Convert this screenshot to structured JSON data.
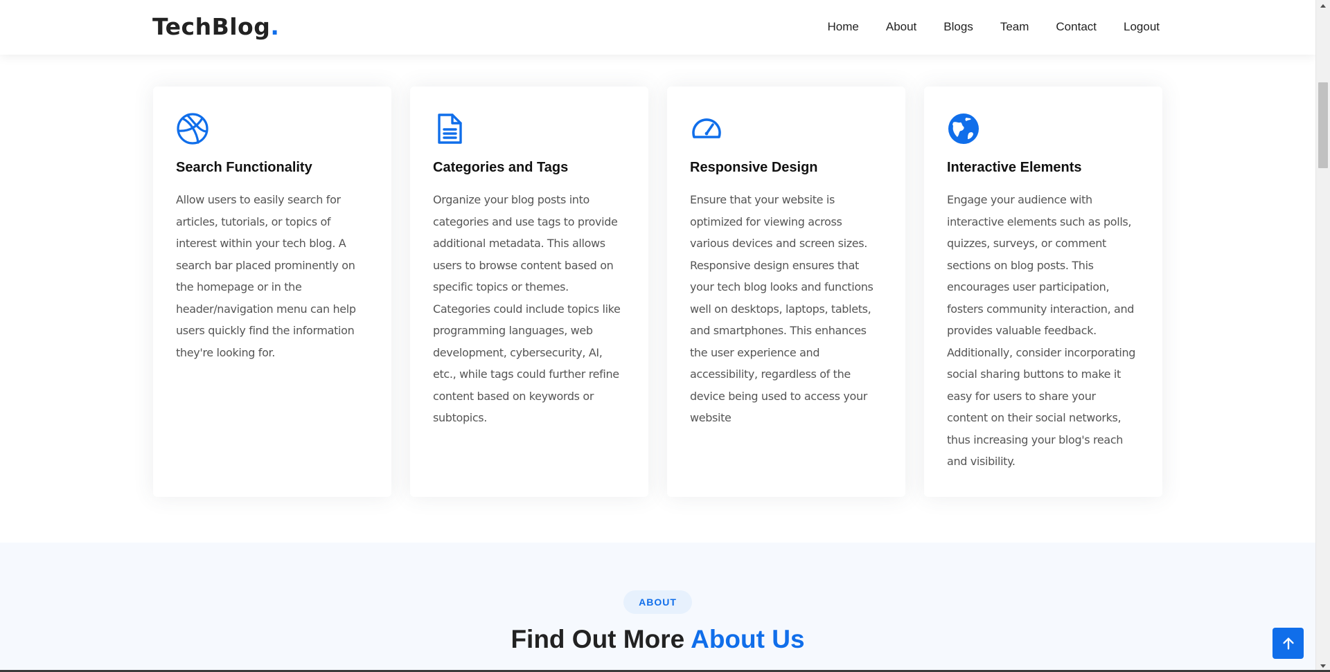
{
  "header": {
    "logo_text": "TechBlog",
    "logo_dot": ".",
    "nav": [
      "Home",
      "About",
      "Blogs",
      "Team",
      "Contact",
      "Logout"
    ]
  },
  "features": [
    {
      "icon": "dribbble-icon",
      "title": "Search Functionality",
      "text": "Allow users to easily search for articles, tutorials, or topics of interest within your tech blog. A search bar placed prominently on the homepage or in the header/navigation menu can help users quickly find the information they're looking for."
    },
    {
      "icon": "document-text-icon",
      "title": "Categories and Tags",
      "text": "Organize your blog posts into categories and use tags to provide additional metadata. This allows users to browse content based on specific topics or themes. Categories could include topics like programming languages, web development, cybersecurity, AI, etc., while tags could further refine content based on keywords or subtopics."
    },
    {
      "icon": "speedometer-icon",
      "title": "Responsive Design",
      "text": "Ensure that your website is optimized for viewing across various devices and screen sizes. Responsive design ensures that your tech blog looks and functions well on desktops, laptops, tablets, and smartphones. This enhances the user experience and accessibility, regardless of the device being used to access your website"
    },
    {
      "icon": "globe-icon",
      "title": "Interactive Elements",
      "text": "Engage your audience with interactive elements such as polls, quizzes, surveys, or comment sections on blog posts. This encourages user participation, fosters community interaction, and provides valuable feedback. Additionally, consider incorporating social sharing buttons to make it easy for users to share your content on their social networks, thus increasing your blog's reach and visibility."
    }
  ],
  "about": {
    "badge": "ABOUT",
    "heading_plain": "Find Out More",
    "heading_accent": "About Us"
  },
  "colors": {
    "accent": "#106eea",
    "section_bg": "#f6f9fe",
    "badge_bg": "#e7f1fd"
  },
  "back_to_top_icon": "arrow-up-icon"
}
